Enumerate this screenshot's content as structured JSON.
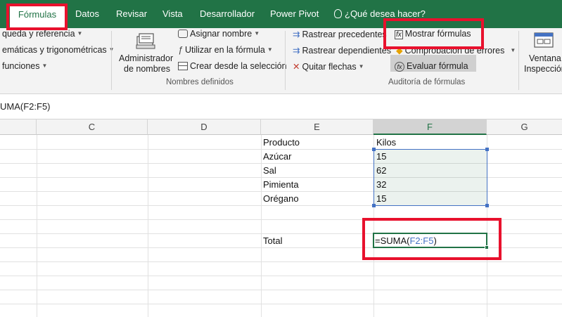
{
  "tabs": {
    "active": "Fórmulas",
    "datos": "Datos",
    "revisar": "Revisar",
    "vista": "Vista",
    "desarrollador": "Desarrollador",
    "power_pivot": "Power Pivot",
    "tell_me": "¿Qué desea hacer?"
  },
  "ribbon": {
    "library": {
      "lookup": "queda y referencia",
      "math": "emáticas y trigonométricas",
      "more": "funciones"
    },
    "defined_names": {
      "manager_line1": "Administrador",
      "manager_line2": "de nombres",
      "define_name": "Asignar nombre",
      "use_in_formula": "Utilizar en la fórmula",
      "create_from_selection": "Crear desde la selección",
      "group_label": "Nombres definidos"
    },
    "auditing": {
      "trace_precedents": "Rastrear precedentes",
      "trace_dependents": "Rastrear dependientes",
      "remove_arrows": "Quitar flechas",
      "show_formulas": "Mostrar fórmulas",
      "error_checking": "Comprobación de errores",
      "evaluate_formula": "Evaluar fórmula",
      "group_label": "Auditoría de fórmulas"
    },
    "watch": {
      "line1": "Ventana",
      "line2": "Inspección"
    }
  },
  "formula_bar": {
    "content": "UMA(F2:F5)"
  },
  "columns": [
    "C",
    "D",
    "E",
    "F",
    "G"
  ],
  "cells": {
    "e_header": "Producto",
    "f_header": "Kilos",
    "items": [
      {
        "product": "Azúcar",
        "kilos": "15"
      },
      {
        "product": "Sal",
        "kilos": "62"
      },
      {
        "product": "Pimienta",
        "kilos": "32"
      },
      {
        "product": "Orégano",
        "kilos": "15"
      }
    ],
    "total_label": "Total",
    "total_formula_prefix": "=SUMA(",
    "total_formula_ref": "F2:F5",
    "total_formula_suffix": ")"
  },
  "colors": {
    "excel_green": "#217346",
    "annotation_red": "#e8112d",
    "range_blue": "#4472c4"
  }
}
